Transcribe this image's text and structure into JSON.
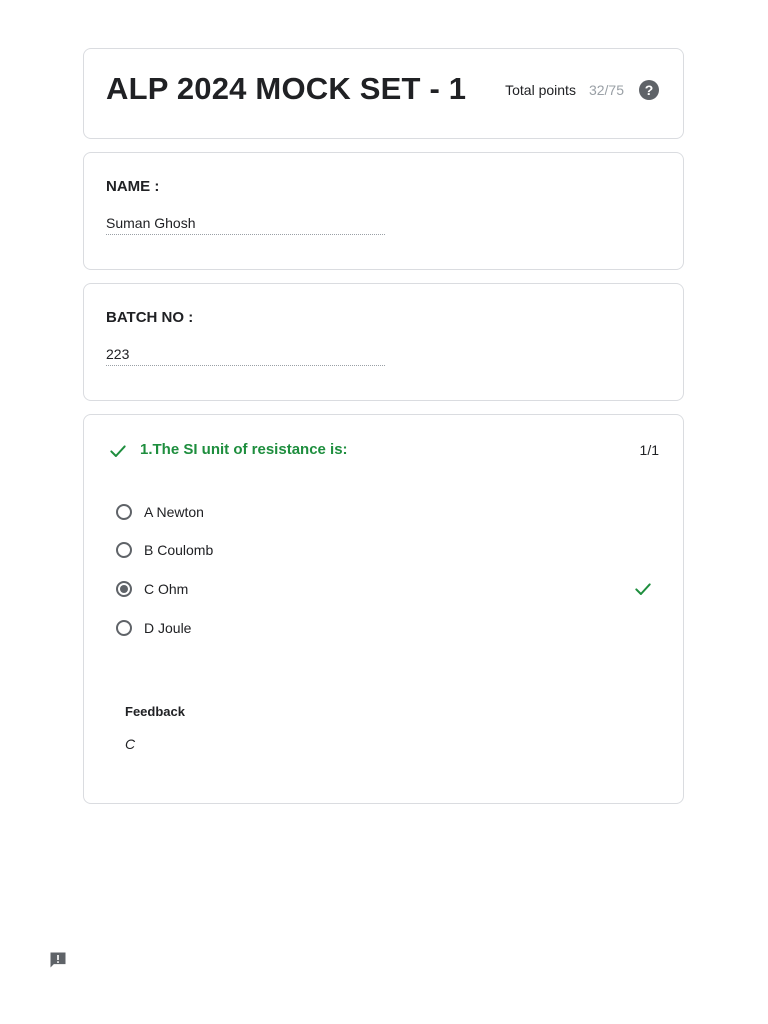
{
  "form": {
    "title": "ALP 2024 MOCK SET - 1",
    "total_points_label": "Total points",
    "total_points_value": "32/75"
  },
  "fields": {
    "name": {
      "label": "NAME :",
      "value": "Suman Ghosh"
    },
    "batch": {
      "label": "BATCH NO :",
      "value": "223"
    }
  },
  "question": {
    "title": "1.The SI unit of resistance is:",
    "score": "1/1",
    "options": [
      {
        "label": "A Newton",
        "selected": false
      },
      {
        "label": "B Coulomb",
        "selected": false
      },
      {
        "label": "C Ohm",
        "selected": true
      },
      {
        "label": "D Joule",
        "selected": false
      }
    ],
    "feedback_label": "Feedback",
    "feedback_text": "C"
  },
  "colors": {
    "correct": "#1e8e3e",
    "muted": "#9aa0a6",
    "icon": "#5f6368",
    "border": "#dadce0"
  },
  "icons": {
    "help": "help-icon",
    "question_correct": "check-icon",
    "option_correct": "check-icon",
    "report": "report-problem-icon"
  }
}
